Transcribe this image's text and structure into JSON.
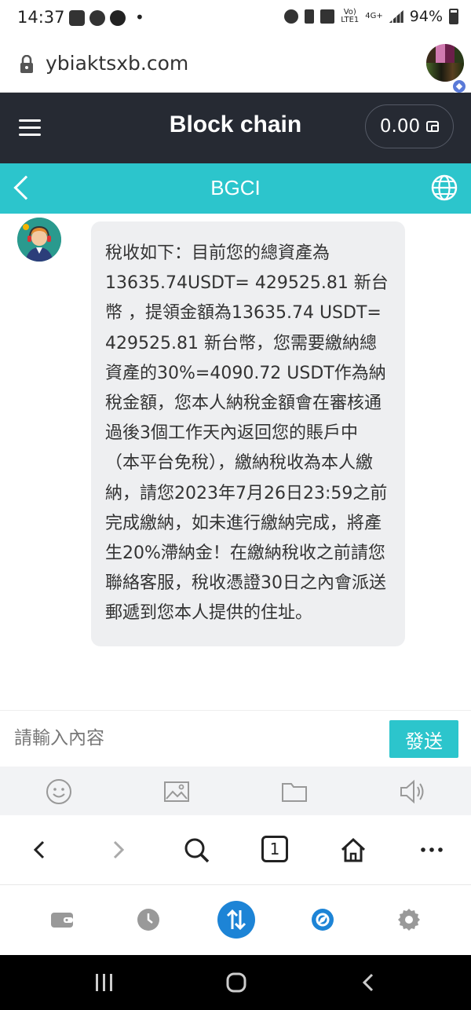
{
  "status_bar": {
    "time": "14:37",
    "dot": "•",
    "network_top": "Vo)",
    "network_bottom": "LTE1",
    "net_type": "4G+",
    "battery": "94%"
  },
  "browser": {
    "url": "ybiaktsxb.com",
    "tab_count": "1",
    "profile_badge_icon": "ethereum-icon"
  },
  "app_header": {
    "title": "Block chain",
    "balance": "0.00"
  },
  "chat_header": {
    "title": "BGCI"
  },
  "messages": [
    {
      "sender": "agent",
      "text": "稅收如下：目前您的總資產為 13635.74USDT= 429525.81 新台幣 ，提領金額為13635.74 USDT= 429525.81 新台幣，您需要繳納總資產的30%=4090.72 USDT作為納稅金額，您本人納稅金額會在審核通過後3個工作天內返回您的賬戶中（本平台免稅），繳納稅收為本人繳納，請您2023年7月26日23:59之前完成繳納，如未進行繳納完成，將產生20%滯納金！在繳納稅收之前請您聯絡客服，稅收憑證30日之內會派送郵遞到您本人提供的住址。"
    }
  ],
  "composer": {
    "placeholder": "請輸入內容",
    "value": "",
    "send_label": "發送"
  },
  "colors": {
    "header_dark": "#262a33",
    "accent_teal": "#2cc5cc",
    "bubble_bg": "#eeeff1",
    "tools_bg": "#f2f3f5",
    "primary_blue": "#1d84d6"
  }
}
